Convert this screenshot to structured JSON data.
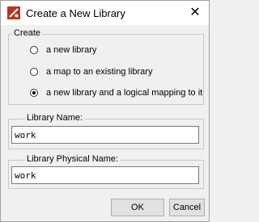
{
  "window": {
    "title": "Create a New Library",
    "app_icon": "modelsim-icon",
    "close_glyph": "✕"
  },
  "create_group": {
    "legend": "Create",
    "options": [
      {
        "label": "a new library",
        "checked": false
      },
      {
        "label": "a map to an existing library",
        "checked": false
      },
      {
        "label": "a new library and a logical mapping to it",
        "checked": true
      }
    ]
  },
  "library_name": {
    "legend": "Library Name:",
    "value": "work"
  },
  "library_physical_name": {
    "legend": "Library Physical Name:",
    "value": "work"
  },
  "buttons": {
    "ok": "OK",
    "cancel": "Cancel"
  },
  "colors": {
    "accent_icon": "#b5361f",
    "background": "#f0f0f0"
  }
}
